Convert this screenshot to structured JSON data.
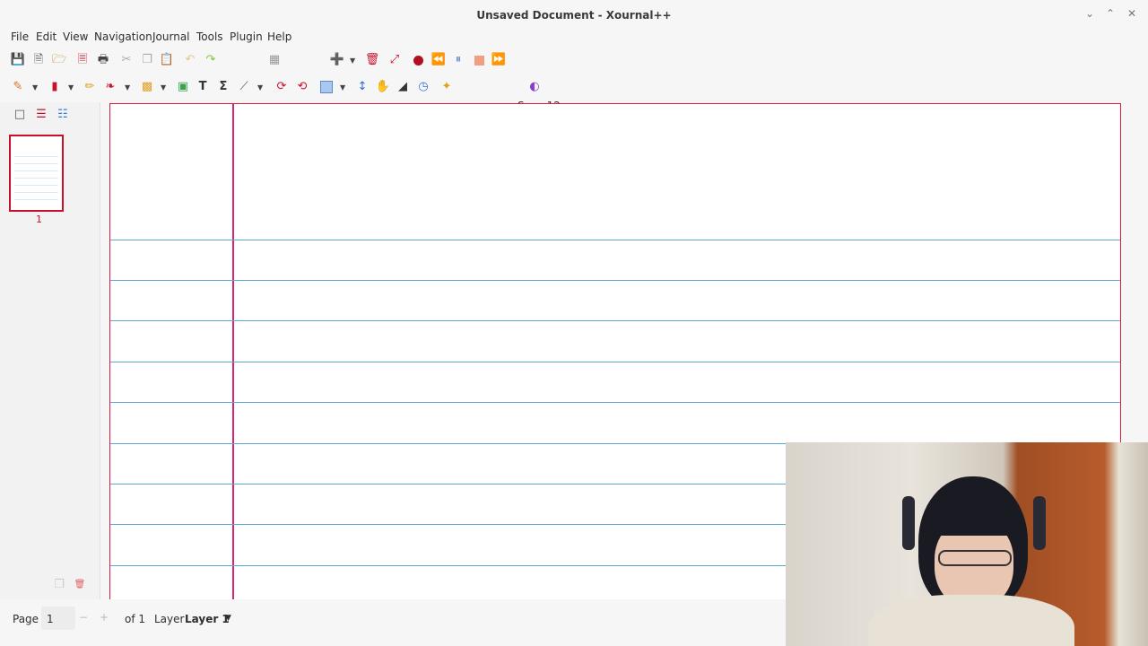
{
  "window": {
    "title": "Unsaved Document - Xournal++"
  },
  "menubar": {
    "items": [
      "File",
      "Edit",
      "View",
      "Navigation",
      "Journal",
      "Tools",
      "Plugin",
      "Help"
    ]
  },
  "font": {
    "label": "Sans  12"
  },
  "colors": {
    "accent": "#c8102e",
    "margin_line": "#d4267a",
    "ruled_line": "#5aa7cf",
    "palette": [
      "#000000",
      "#008000",
      "#00c0ff",
      "#00ff00",
      "#3333cc",
      "#808080",
      "#ff0000",
      "#ff00ff",
      "#ff8000",
      "#ffff00",
      "#ffffff"
    ]
  },
  "sidebar": {
    "thumbnail_number": "1"
  },
  "status": {
    "page_label": "Page",
    "page_value": "1",
    "of_label": "of 1",
    "layer_label": "Layer",
    "layer_value": "Layer 1"
  }
}
